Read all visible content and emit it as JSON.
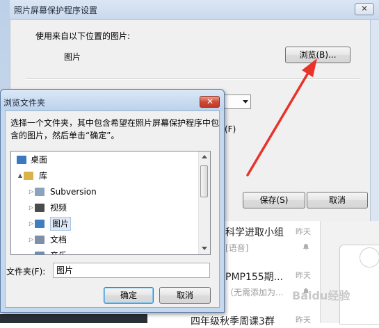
{
  "settings_window": {
    "title": "照片屏幕保护程序设置",
    "close_glyph": "✕",
    "use_pictures_label": "使用来自以下位置的图片:",
    "folder_name": "图片",
    "browse_button": "浏览(B)...",
    "shortcut_fragment": "(F)",
    "save_button": "保存(S)",
    "cancel_button": "取消"
  },
  "browse_dialog": {
    "title": "浏览文件夹",
    "instruction": "选择一个文件夹，其中包含希望在照片屏幕保护程序中包含的图片，然后单击“确定”。",
    "tree": [
      {
        "label": "桌面",
        "icon": "desktop-icon",
        "expander": "",
        "selected": false
      },
      {
        "label": "库",
        "icon": "library-icon",
        "expander": "▲",
        "selected": false
      },
      {
        "label": "Subversion",
        "icon": "document-folder-icon",
        "expander": "▷",
        "selected": false
      },
      {
        "label": "视频",
        "icon": "video-folder-icon",
        "expander": "▷",
        "selected": false
      },
      {
        "label": "图片",
        "icon": "pictures-folder-icon",
        "expander": "▷",
        "selected": true
      },
      {
        "label": "文档",
        "icon": "documents-folder-icon",
        "expander": "▷",
        "selected": false
      },
      {
        "label": "音乐",
        "icon": "music-folder-icon",
        "expander": "",
        "selected": false
      }
    ],
    "folder_label": "文件夹(F):",
    "folder_value": "图片",
    "ok_button": "确定",
    "cancel_button": "取消"
  },
  "chat_list": [
    {
      "title": "科学进取小组",
      "subtitle": "[语音]",
      "time": "昨天"
    },
    {
      "title": "PMP155期...",
      "subtitle": "（无需添加为...",
      "time": "昨天"
    },
    {
      "title": "四年级秋季周课3群",
      "subtitle": "",
      "time": "昨天"
    }
  ],
  "watermark": "Baidu经验",
  "colors": {
    "annotation_arrow": "#e8322a",
    "close_button_red": "#c13a27",
    "selection_highlight": "#dfe9f5"
  }
}
